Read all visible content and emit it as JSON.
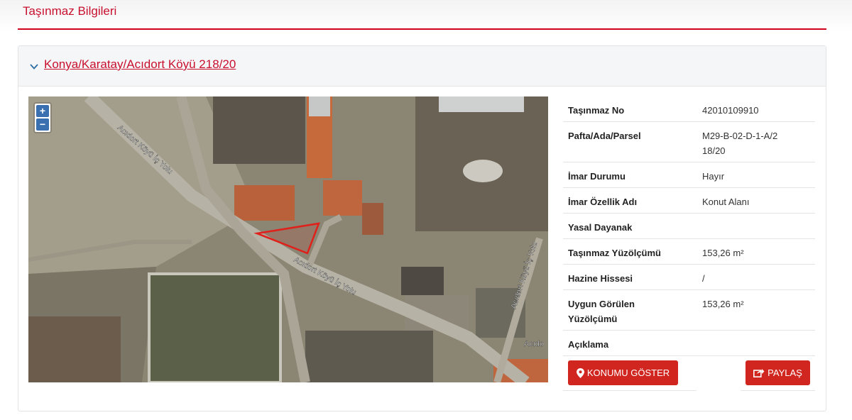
{
  "page": {
    "title": "Taşınmaz Bilgileri"
  },
  "panel": {
    "heading": "Konya/Karatay/Acıdort Köyü 218/20"
  },
  "map": {
    "zoom_in": "+",
    "zoom_out": "−",
    "road_labels": [
      "Acıdort Köyü İç Yolu",
      "Acıdort Köyü İç Yolu",
      "Acıdort Köyü İç Yolu",
      "Acıdo"
    ]
  },
  "info": [
    {
      "label": "Taşınmaz No",
      "value": "42010109910"
    },
    {
      "label": "Pafta/Ada/Parsel",
      "value": "M29-B-02-D-1-A/218/20"
    },
    {
      "label": "İmar Durumu",
      "value": "Hayır"
    },
    {
      "label": "İmar Özellik Adı",
      "value": "Konut Alanı"
    },
    {
      "label": "Yasal Dayanak",
      "value": ""
    },
    {
      "label": "Taşınmaz Yüzölçümü",
      "value": "153,26 m²"
    },
    {
      "label": "Hazine Hissesi",
      "value": "/"
    },
    {
      "label": "Uygun Görülen Yüzölçümü",
      "value": "153,26 m²"
    },
    {
      "label": "Açıklama",
      "value": ""
    }
  ],
  "buttons": {
    "konum": "KONUMU GÖSTER",
    "paylas": "PAYLAŞ"
  },
  "colors": {
    "accent": "#c8102e",
    "button": "#d0261f",
    "parcel": "#e0201b"
  }
}
